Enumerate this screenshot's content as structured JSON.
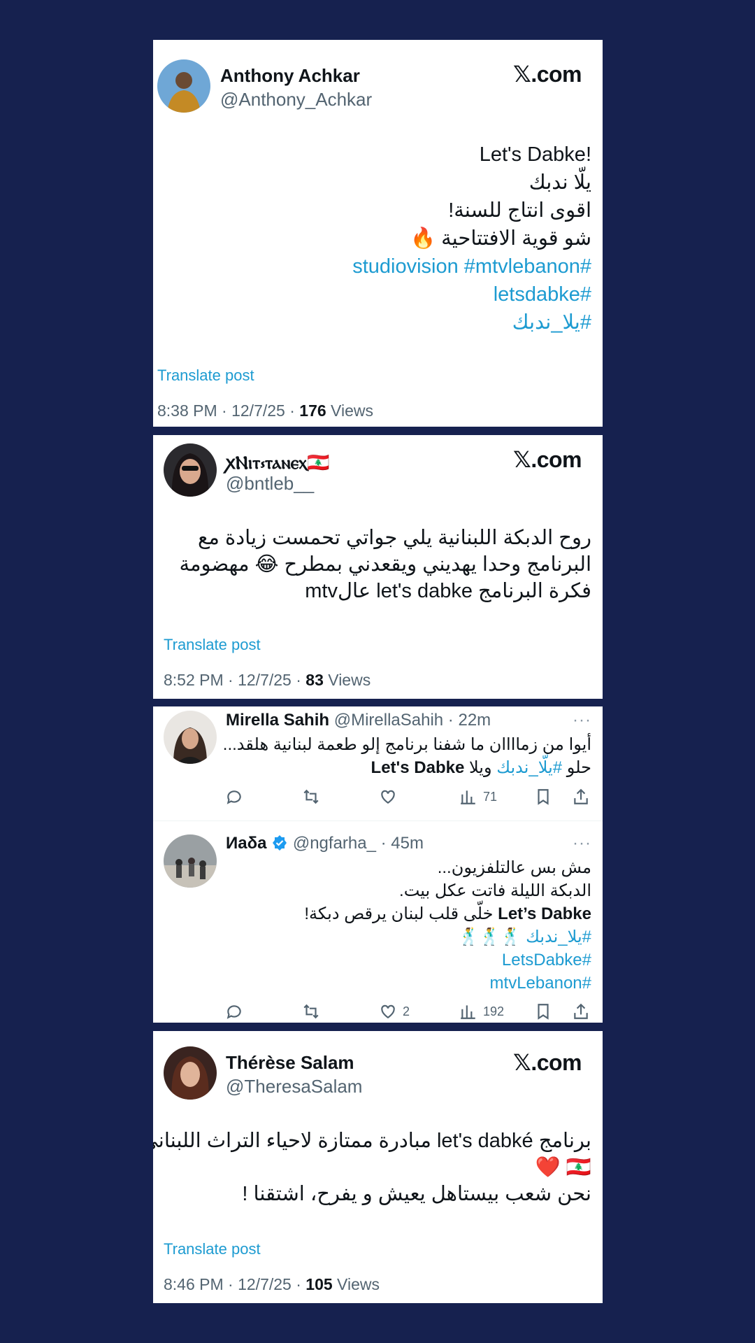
{
  "cards": [
    {
      "name": "Anthony Achkar",
      "handle": "@Anthony_Achkar",
      "brand": "𝕏.com",
      "lines": [
        "!Let's Dabke",
        "يلّا ندبك",
        "اقوى انتاج  للسنة!",
        "شو قوية الافتتاحية 🔥"
      ],
      "tags": [
        "#studiovision #mtvlebanon",
        "#letsdabke",
        "#يلا_ندبك"
      ],
      "translate": "Translate post",
      "time": "8:38 PM · 12/7/25 · ",
      "views": "176",
      "views_label": " Views"
    },
    {
      "name": "ꭗⲚⲓⲧ⳽ⲧⲁⲛⲉⲭ🇱🇧",
      "handle": "@bntleb__",
      "brand": "𝕏.com",
      "lines": [
        "روح الدبكة اللبنانية يلي جواتي  تحمست زيادة مع",
        "البرنامج وحدا يهديني ويقعدني بمطرح 😂 مهضومة",
        "فكرة البرنامج let's dabke عالmtv"
      ],
      "translate": "Translate post",
      "time": "8:52 PM · 12/7/25 · ",
      "views": "83",
      "views_label": " Views"
    },
    {
      "replies": [
        {
          "name": "Mirella Sahih",
          "handle": "@MirellaSahih · 22m",
          "dots": "···",
          "lines": [
            "أيوا من زماااان ما شفنا برنامج إلو طعمة لبنانية هلقد..."
          ],
          "last_pre": "حلو ",
          "last_tag": "#يلّا_ندبك",
          "last_mid": " ويلا ",
          "last_bold": "Let's Dabke",
          "views": "71",
          "likes": ""
        },
        {
          "name": "Иаδа",
          "handle": "@ngfarha_ · 45m",
          "dots": "···",
          "lines": [
            "مش بس عالتلفزيون...",
            "الدبكة الليلة فاتت عكل بيت."
          ],
          "bold_line_bold": "Let’s Dabke",
          "bold_line_rest": " خلّى قلب لبنان يرقص دبكة!",
          "tags": [
            "#يلا_ندبك 🕺🕺🕺",
            "#LetsDabke",
            "#mtvLebanon"
          ],
          "views": "192",
          "likes": "2"
        }
      ]
    },
    {
      "name": "Thérèse Salam",
      "handle": "@TheresaSalam",
      "brand": "𝕏.com",
      "lines": [
        "برنامج let's dabké مبادرة ممتازة لاحياء التراث اللبناني",
        "🇱🇧 ❤️",
        "نحن شعب بيستاهل يعيش و يفرح، اشتقنا !"
      ],
      "translate": "Translate post",
      "time": "8:46 PM · 12/7/25 · ",
      "views": "105",
      "views_label": " Views"
    }
  ]
}
